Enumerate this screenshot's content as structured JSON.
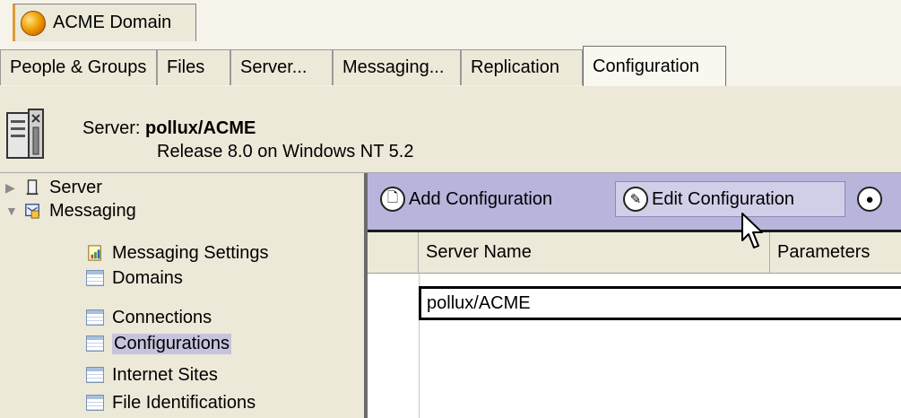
{
  "domain_tab": {
    "label": "ACME Domain",
    "icon": "domain-globe-icon"
  },
  "nav_tabs": [
    {
      "label": "People & Groups",
      "active": false
    },
    {
      "label": "Files",
      "active": false
    },
    {
      "label": "Server...",
      "active": false
    },
    {
      "label": "Messaging...",
      "active": false
    },
    {
      "label": "Replication",
      "active": false
    },
    {
      "label": "Configuration",
      "active": true
    }
  ],
  "server_header": {
    "prefix": "Server: ",
    "server_name": "pollux/ACME",
    "release": "Release 8.0 on Windows NT 5.2"
  },
  "tree": [
    {
      "label": "Server",
      "icon": "server-icon",
      "twisty": "collapsed"
    },
    {
      "label": "Messaging",
      "icon": "messaging-icon",
      "twisty": "expanded"
    },
    {
      "label": "Messaging Settings",
      "icon": "settings-document-icon"
    },
    {
      "label": "Domains",
      "icon": "view-icon"
    },
    {
      "label": "Connections",
      "icon": "view-icon"
    },
    {
      "label": "Configurations",
      "icon": "view-icon",
      "selected": true
    },
    {
      "label": "Internet Sites",
      "icon": "view-icon"
    },
    {
      "label": "File Identifications",
      "icon": "view-icon"
    }
  ],
  "actions": {
    "add": "Add Configuration",
    "edit": "Edit Configuration"
  },
  "columns": [
    "Server Name",
    "Parameters"
  ],
  "rows": [
    {
      "server_name": "pollux/ACME"
    }
  ],
  "colors": {
    "window_bg": "#ece9d8",
    "action_bar_bg": "#b7b5db",
    "selection_bg": "#c6c3dd",
    "domain_tab_accent": "#d99a3a"
  }
}
